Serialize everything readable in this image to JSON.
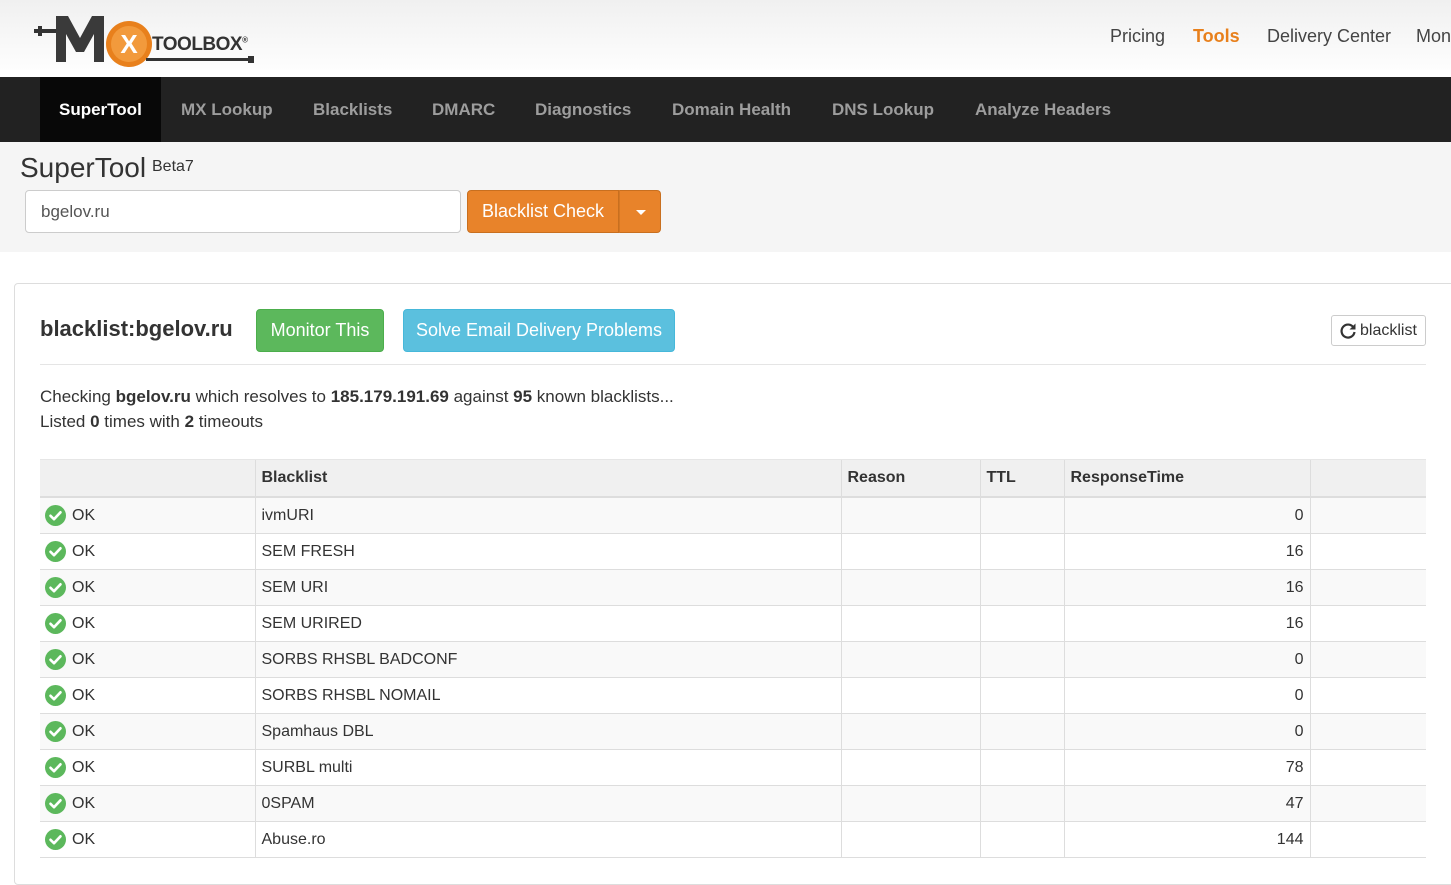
{
  "header": {
    "logo": {
      "letters": "MX",
      "text": "TOOLBOX",
      "reg": "®"
    },
    "nav": [
      {
        "label": "Pricing",
        "active": false
      },
      {
        "label": "Tools",
        "active": true
      },
      {
        "label": "Delivery Center",
        "active": false
      },
      {
        "label": "Mon",
        "active": false
      }
    ]
  },
  "mainnav": [
    "SuperTool",
    "MX Lookup",
    "Blacklists",
    "DMARC",
    "Diagnostics",
    "Domain Health",
    "DNS Lookup",
    "Analyze Headers"
  ],
  "supertool": {
    "title": "SuperTool",
    "beta": "Beta7",
    "input_value": "bgelov.ru",
    "action_label": "Blacklist Check"
  },
  "result": {
    "title": "blacklist:bgelov.ru",
    "monitor_label": "Monitor This",
    "solve_label": "Solve Email Delivery Problems",
    "refresh_label": "blacklist",
    "summary": {
      "p1": "Checking ",
      "domain": "bgelov.ru",
      "p2": " which resolves to ",
      "ip": "185.179.191.69",
      "p3": " against ",
      "count": "95",
      "p4": " known blacklists...",
      "l1": "Listed ",
      "listed": "0",
      "l2": " times with ",
      "timeouts": "2",
      "l3": " timeouts"
    }
  },
  "table": {
    "headers": [
      "",
      "Blacklist",
      "Reason",
      "TTL",
      "ResponseTime",
      ""
    ],
    "rows": [
      {
        "status": "OK",
        "blacklist": "ivmURI",
        "reason": "",
        "ttl": "",
        "time": "0"
      },
      {
        "status": "OK",
        "blacklist": "SEM FRESH",
        "reason": "",
        "ttl": "",
        "time": "16"
      },
      {
        "status": "OK",
        "blacklist": "SEM URI",
        "reason": "",
        "ttl": "",
        "time": "16"
      },
      {
        "status": "OK",
        "blacklist": "SEM URIRED",
        "reason": "",
        "ttl": "",
        "time": "16"
      },
      {
        "status": "OK",
        "blacklist": "SORBS RHSBL BADCONF",
        "reason": "",
        "ttl": "",
        "time": "0"
      },
      {
        "status": "OK",
        "blacklist": "SORBS RHSBL NOMAIL",
        "reason": "",
        "ttl": "",
        "time": "0"
      },
      {
        "status": "OK",
        "blacklist": "Spamhaus DBL",
        "reason": "",
        "ttl": "",
        "time": "0"
      },
      {
        "status": "OK",
        "blacklist": "SURBL multi",
        "reason": "",
        "ttl": "",
        "time": "78"
      },
      {
        "status": "OK",
        "blacklist": "0SPAM",
        "reason": "",
        "ttl": "",
        "time": "47"
      },
      {
        "status": "OK",
        "blacklist": "Abuse.ro",
        "reason": "",
        "ttl": "",
        "time": "144"
      }
    ]
  },
  "colors": {
    "accent": "#e8801c",
    "ok": "#5cb85c",
    "info": "#5bc0de",
    "nav_bg": "#222222"
  }
}
